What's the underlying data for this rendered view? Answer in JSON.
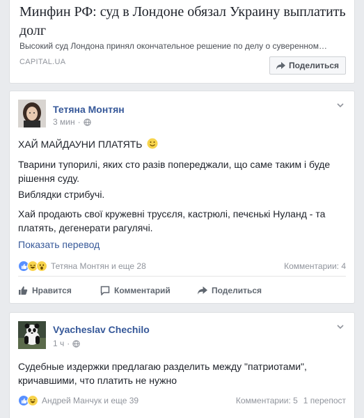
{
  "link_preview": {
    "title": "Минфин РФ: суд в Лондоне обязал Украину выплатить долг",
    "description": "Высокий суд Лондона принял окончательное решение по делу о суверенном…",
    "domain": "CAPITAL.UA",
    "share_label": "Поделиться"
  },
  "posts": [
    {
      "author": "Тетяна Монтян",
      "time": "3 мин",
      "audience_icon": "globe-icon",
      "headline": "ХАЙ МАЙДАУНИ ПЛАТЯТЬ",
      "paragraphs": [
        "Тварини тупорилі, яких сто разів попереджали, що саме таким і буде рішення суду.",
        "Виблядки стрибучі.",
        "Хай продають свої кружевні трусєля, кастрюлі, печєнькі Нуланд - та платять, дегенерати рагулячі."
      ],
      "translate_label": "Показать перевод",
      "reactions_text": "Тетяна Монтян и еще 28",
      "comments_text": "Комментарии: 4",
      "actions": {
        "like": "Нравится",
        "comment": "Комментарий",
        "share": "Поделиться"
      }
    },
    {
      "author": "Vyacheslav Chechilo",
      "time": "1 ч",
      "audience_icon": "globe-icon",
      "paragraphs": [
        "Судебные издержки предлагаю разделить между \"патриотами\", кричавшими, что платить не нужно"
      ],
      "reactions_text": "Андрей Манчук и еще 39",
      "comments_text": "Комментарии: 5",
      "shares_text": "1 перепост"
    }
  ],
  "colors": {
    "link": "#365899",
    "background": "#e9ebee",
    "like_blue": "#5890ff"
  }
}
